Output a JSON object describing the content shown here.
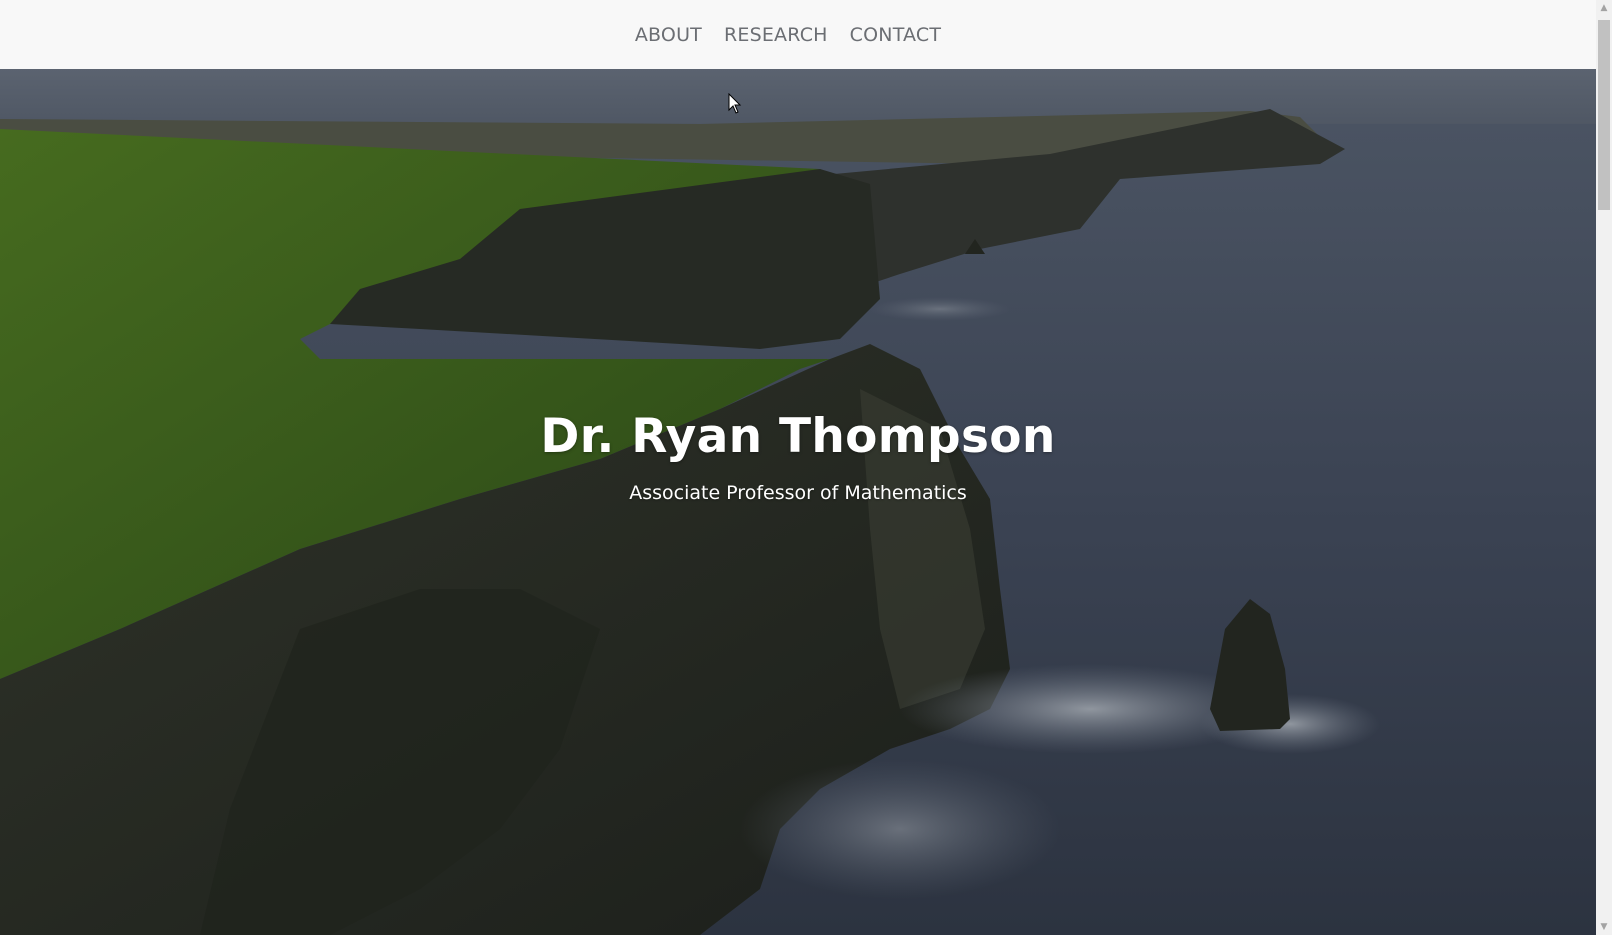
{
  "nav": {
    "items": [
      {
        "label": "ABOUT"
      },
      {
        "label": "RESEARCH"
      },
      {
        "label": "CONTACT"
      }
    ]
  },
  "hero": {
    "title": "Dr. Ryan Thompson",
    "subtitle": "Associate Professor of Mathematics"
  },
  "scrollbar": {
    "up_arrow": "▲",
    "down_arrow": "▼"
  },
  "colors": {
    "navbar_bg": "#f8f8f8",
    "nav_text": "#6b6e73",
    "hero_text": "#ffffff",
    "sea": "#3a4150",
    "grass": "#3a5a1a"
  }
}
